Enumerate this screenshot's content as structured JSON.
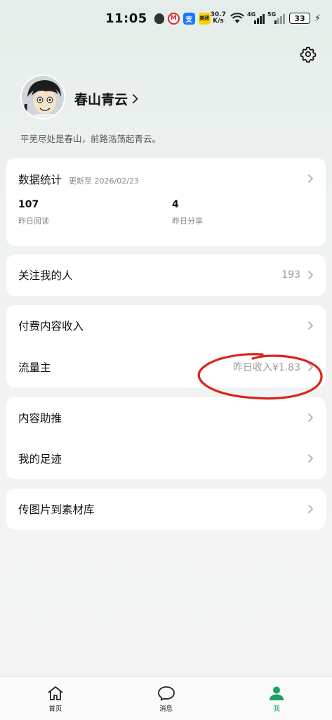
{
  "status_bar": {
    "time": "11:05",
    "net_speed_value": "30.7",
    "net_speed_unit": "K/s",
    "signal1_label": "4G",
    "signal2_label": "5G",
    "battery": "33"
  },
  "profile": {
    "name": "春山青云",
    "bio": "平芜尽处是春山，前路浩荡起青云。"
  },
  "stats": {
    "title": "数据统计",
    "updated": "更新至 2026/02/23",
    "reads_value": "107",
    "reads_label": "昨日阅读",
    "shares_value": "4",
    "shares_label": "昨日分享"
  },
  "followers": {
    "label": "关注我的人",
    "count": "193"
  },
  "income": {
    "paid_label": "付费内容收入",
    "traffic_label": "流量主",
    "traffic_value": "昨日收入¥1.83"
  },
  "tools": {
    "promote_label": "内容助推",
    "footprint_label": "我的足迹"
  },
  "upload": {
    "label": "传图片到素材库"
  },
  "nav": {
    "home": "首页",
    "messages": "消息",
    "me": "我"
  },
  "colors": {
    "accent": "#1aa260",
    "annotation": "#d9241c"
  }
}
